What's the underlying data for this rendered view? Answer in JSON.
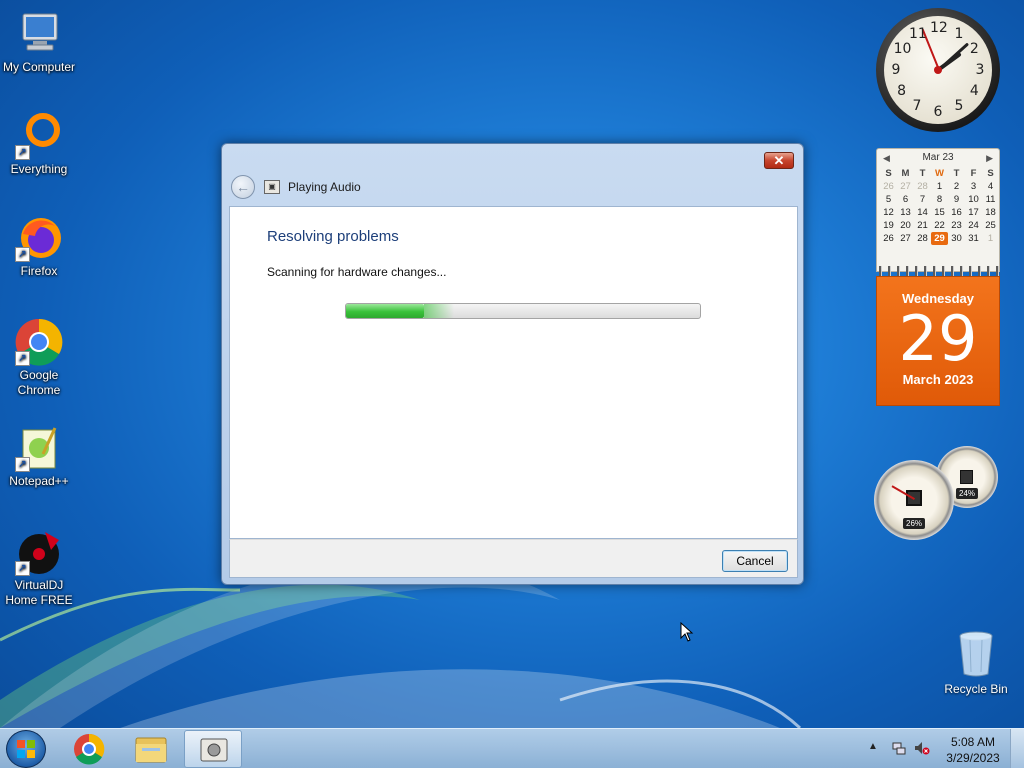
{
  "desktop": {
    "icons": [
      {
        "label": "My Computer",
        "icon": "computer-icon"
      },
      {
        "label": "Everything",
        "icon": "everything-icon"
      },
      {
        "label": "Firefox",
        "icon": "firefox-icon"
      },
      {
        "label": "Google Chrome",
        "icon": "chrome-icon"
      },
      {
        "label": "Notepad++",
        "icon": "notepadplusplus-icon"
      },
      {
        "label": "VirtualDJ Home FREE",
        "icon": "virtualdj-icon"
      }
    ],
    "recycle_bin": {
      "label": "Recycle Bin",
      "icon": "recycle-bin-icon"
    },
    "shortcut_glyph": "↗"
  },
  "gadgets": {
    "clock": {
      "numbers": [
        "12",
        "1",
        "2",
        "3",
        "4",
        "5",
        "6",
        "7",
        "8",
        "9",
        "10",
        "11"
      ],
      "time": "5:08"
    },
    "calendar": {
      "month_label": "Mar 23",
      "prev": "◀",
      "next": "▶",
      "weekdays": [
        "S",
        "M",
        "T",
        "W",
        "T",
        "F",
        "S"
      ],
      "today_weekday_index": 3,
      "days": [
        {
          "d": "26",
          "dim": true
        },
        {
          "d": "27",
          "dim": true
        },
        {
          "d": "28",
          "dim": true
        },
        {
          "d": "1"
        },
        {
          "d": "2"
        },
        {
          "d": "3"
        },
        {
          "d": "4"
        },
        {
          "d": "5"
        },
        {
          "d": "6"
        },
        {
          "d": "7"
        },
        {
          "d": "8"
        },
        {
          "d": "9"
        },
        {
          "d": "10"
        },
        {
          "d": "11"
        },
        {
          "d": "12"
        },
        {
          "d": "13"
        },
        {
          "d": "14"
        },
        {
          "d": "15"
        },
        {
          "d": "16"
        },
        {
          "d": "17"
        },
        {
          "d": "18"
        },
        {
          "d": "19"
        },
        {
          "d": "20"
        },
        {
          "d": "21"
        },
        {
          "d": "22"
        },
        {
          "d": "23"
        },
        {
          "d": "24"
        },
        {
          "d": "25"
        },
        {
          "d": "26"
        },
        {
          "d": "27"
        },
        {
          "d": "28"
        },
        {
          "d": "29",
          "sel": true
        },
        {
          "d": "30"
        },
        {
          "d": "31"
        },
        {
          "d": "1",
          "dim": true
        }
      ],
      "weekday_name": "Wednesday",
      "day_number": "29",
      "month_year": "March 2023"
    },
    "meters": {
      "cpu": "26%",
      "memory": "24%"
    }
  },
  "dialog": {
    "title": "Playing Audio",
    "close_glyph": "✕",
    "back_glyph": "←",
    "heading": "Resolving problems",
    "status": "Scanning for hardware changes...",
    "progress_fraction": 0.22,
    "cancel_label": "Cancel"
  },
  "taskbar": {
    "time": "5:08 AM",
    "date": "3/29/2023",
    "tray_arrow": "▲",
    "apps": [
      {
        "name": "chrome",
        "icon": "chrome-icon"
      },
      {
        "name": "explorer",
        "icon": "folder-icon"
      },
      {
        "name": "troubleshooter",
        "icon": "troubleshooter-icon",
        "active": true
      }
    ]
  },
  "colors": {
    "accent": "#1d3f7a",
    "progress": "#39c23a",
    "calendar": "#e86a10"
  }
}
